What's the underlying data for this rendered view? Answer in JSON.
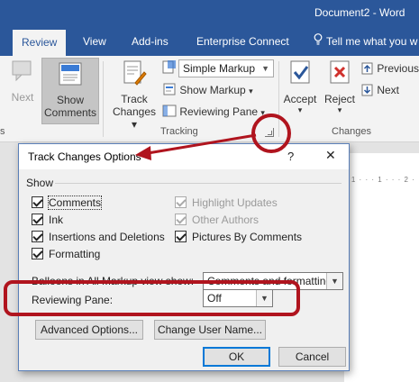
{
  "window": {
    "title": "Document2 - Word"
  },
  "tabs": [
    {
      "label": "Review",
      "active": true
    },
    {
      "label": "View"
    },
    {
      "label": "Add-ins"
    },
    {
      "label": "Enterprise Connect"
    }
  ],
  "tellme": {
    "label": "Tell me what you w"
  },
  "ribbon": {
    "next_label": "Next",
    "show_comments_label_1": "Show",
    "show_comments_label_2": "Comments",
    "track_changes_label_1": "Track",
    "track_changes_label_2": "Changes",
    "markup_combo_value": "Simple Markup",
    "show_markup_label": "Show Markup",
    "reviewing_pane_label": "Reviewing Pane",
    "tracking_group_label": "Tracking",
    "accept_label": "Accept",
    "reject_label": "Reject",
    "previous_label": "Previous",
    "next_change_label": "Next",
    "changes_group_label": "Changes",
    "left_group_label": "s"
  },
  "ruler": {
    "text": "· 1 · · · 1 · · · 2 ·"
  },
  "dialog": {
    "title": "Track Changes Options",
    "help": "?",
    "close": "✕",
    "show_section": "Show",
    "checkboxes_left": [
      {
        "label": "Comments",
        "checked": true
      },
      {
        "label": "Ink",
        "checked": true
      },
      {
        "label": "Insertions and Deletions",
        "checked": true
      },
      {
        "label": "Formatting",
        "checked": true
      }
    ],
    "checkboxes_right": [
      {
        "label": "Highlight Updates",
        "checked": true,
        "disabled": true
      },
      {
        "label": "Other Authors",
        "checked": true,
        "disabled": true
      },
      {
        "label": "Pictures By Comments",
        "checked": true
      }
    ],
    "balloons_label": "Balloons in All Markup view show:",
    "balloons_value": "Comments and formatting",
    "reviewing_pane_label": "Reviewing Pane:",
    "reviewing_pane_value": "Off",
    "advanced_button": "Advanced Options...",
    "change_user_button": "Change User Name...",
    "ok_button": "OK",
    "cancel_button": "Cancel"
  },
  "colors": {
    "title_bar": "#2b579a",
    "callout": "#b0141e"
  }
}
